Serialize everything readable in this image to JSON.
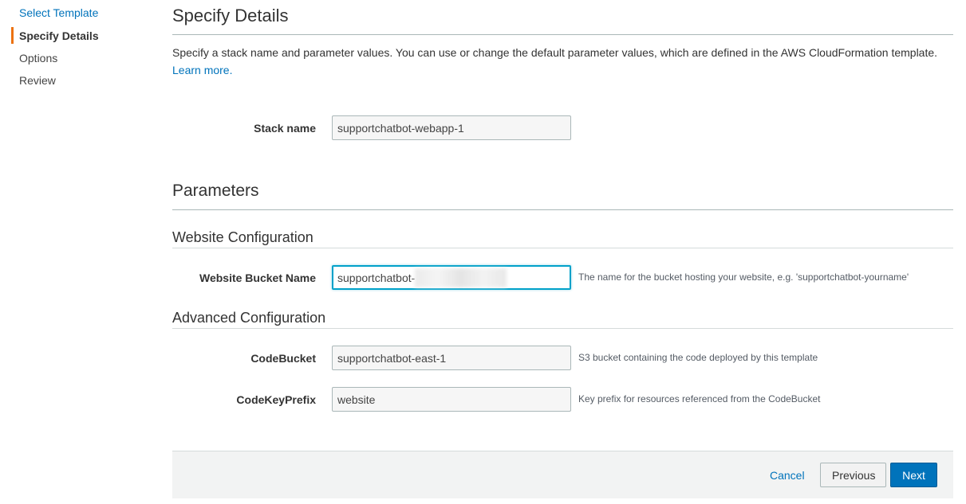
{
  "sidebar": {
    "items": [
      {
        "label": "Select Template"
      },
      {
        "label": "Specify Details"
      },
      {
        "label": "Options"
      },
      {
        "label": "Review"
      }
    ]
  },
  "header": {
    "title": "Specify Details",
    "description": "Specify a stack name and parameter values. You can use or change the default parameter values, which are defined in the AWS CloudFormation template.",
    "learn_more": "Learn more."
  },
  "stack": {
    "label": "Stack name",
    "value": "supportchatbot-webapp-1"
  },
  "parameters": {
    "title": "Parameters",
    "website_config": {
      "title": "Website Configuration",
      "bucket_label": "Website Bucket Name",
      "bucket_value": "supportchatbot-",
      "bucket_hint": "The name for the bucket hosting your website, e.g. 'supportchatbot-yourname'"
    },
    "advanced_config": {
      "title": "Advanced Configuration",
      "code_bucket_label": "CodeBucket",
      "code_bucket_value": "supportchatbot-east-1",
      "code_bucket_hint": "S3 bucket containing the code deployed by this template",
      "code_prefix_label": "CodeKeyPrefix",
      "code_prefix_value": "website",
      "code_prefix_hint": "Key prefix for resources referenced from the CodeBucket"
    }
  },
  "footer": {
    "cancel": "Cancel",
    "previous": "Previous",
    "next": "Next"
  }
}
